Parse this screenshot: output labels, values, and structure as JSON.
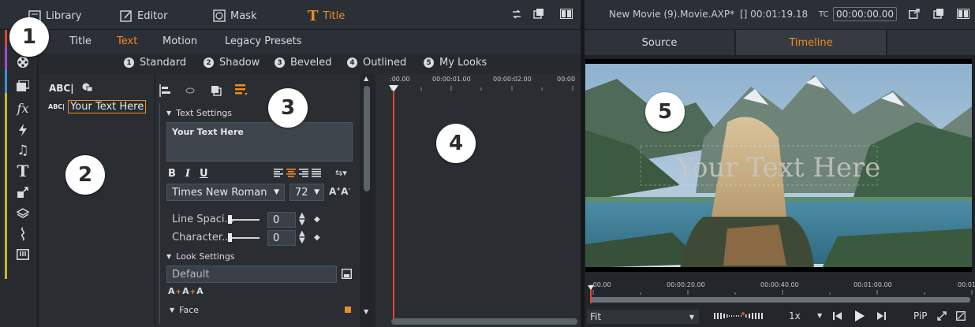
{
  "top_tabs": {
    "library": "Library",
    "editor": "Editor",
    "mask": "Mask",
    "title": "Title"
  },
  "project": {
    "name": "New Movie (9).Movie.AXP*",
    "duration": "[] 00:01:19.18",
    "tc_label": "TC",
    "tc_value": "00:00:00.00"
  },
  "title_tabs": [
    "Title",
    "Text",
    "Motion",
    "Legacy Presets"
  ],
  "look_tabs": [
    {
      "num": "1",
      "label": "Standard"
    },
    {
      "num": "2",
      "label": "Shadow"
    },
    {
      "num": "3",
      "label": "Beveled"
    },
    {
      "num": "4",
      "label": "Outlined"
    },
    {
      "num": "5",
      "label": "My Looks"
    }
  ],
  "layers": {
    "abc_label": "ABC|",
    "item_prefix": "ABC|",
    "item_text": "Your Text Here"
  },
  "text_settings": {
    "header": "Text Settings",
    "text_value": "Your Text Here",
    "font": "Times New Roman",
    "size": "72",
    "line_spacing_label": "Line Spaci...",
    "line_spacing_value": "0",
    "character_label": "Character...",
    "character_value": "0"
  },
  "look_settings": {
    "header": "Look Settings",
    "value": "Default",
    "face_label": "Face"
  },
  "timeline": {
    "ticks": [
      ":00.00",
      "00:00:01.00",
      "00:00:02.00",
      "00:00"
    ]
  },
  "preview": {
    "source_tab": "Source",
    "timeline_tab": "Timeline",
    "overlay_text": "Your Text Here"
  },
  "preview_ruler": {
    "ticks": [
      ":00.00",
      "00:00:20.00",
      "00:00:40.00",
      "00:01:00.00",
      "00:01"
    ]
  },
  "bottom_controls": {
    "fit": "Fit",
    "speed": "1x",
    "pip": "PiP"
  },
  "callouts": [
    "1",
    "2",
    "3",
    "4",
    "5"
  ],
  "colors": {
    "accent": "#f08a24",
    "background": "#2a2e33",
    "playhead": "#e0462e"
  }
}
